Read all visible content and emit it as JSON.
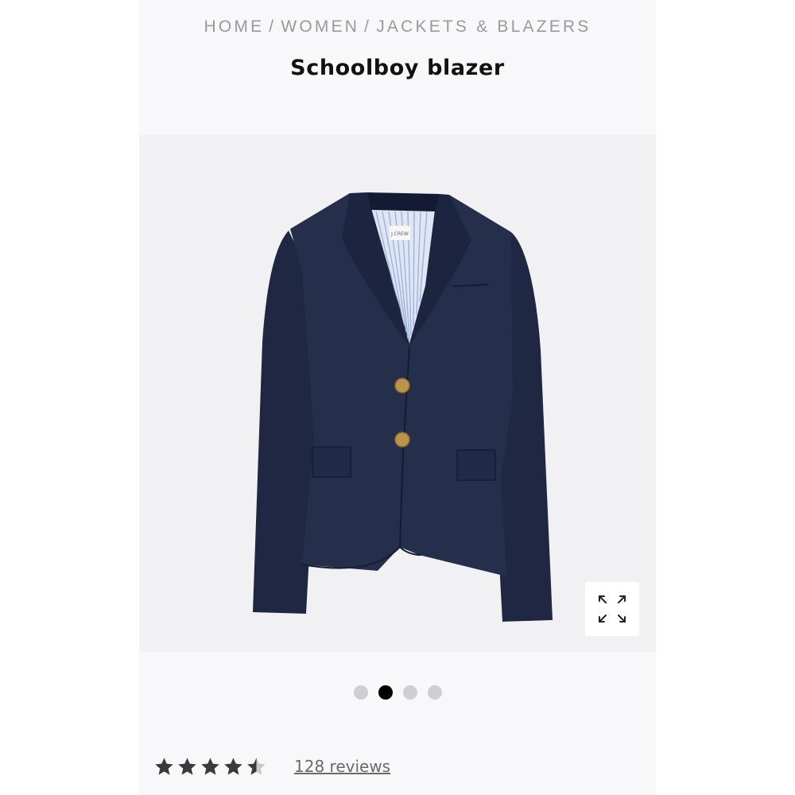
{
  "breadcrumb": {
    "items": [
      "HOME",
      "WOMEN",
      "JACKETS & BLAZERS"
    ],
    "separator": "/"
  },
  "product": {
    "title": "Schoolboy blazer",
    "image_alt": "navy blazer",
    "brand_label": "J.CREW"
  },
  "gallery": {
    "slide_count": 4,
    "active_index": 1,
    "expand_icon": "expand-arrows-icon"
  },
  "rating": {
    "value": 4.5,
    "max": 5,
    "reviews_label": "128 reviews",
    "star_color": "#3a3a3a"
  },
  "colors": {
    "blazer": "#232c48",
    "button_gold": "#b89548",
    "panel_bg": "#f1f1f4"
  }
}
